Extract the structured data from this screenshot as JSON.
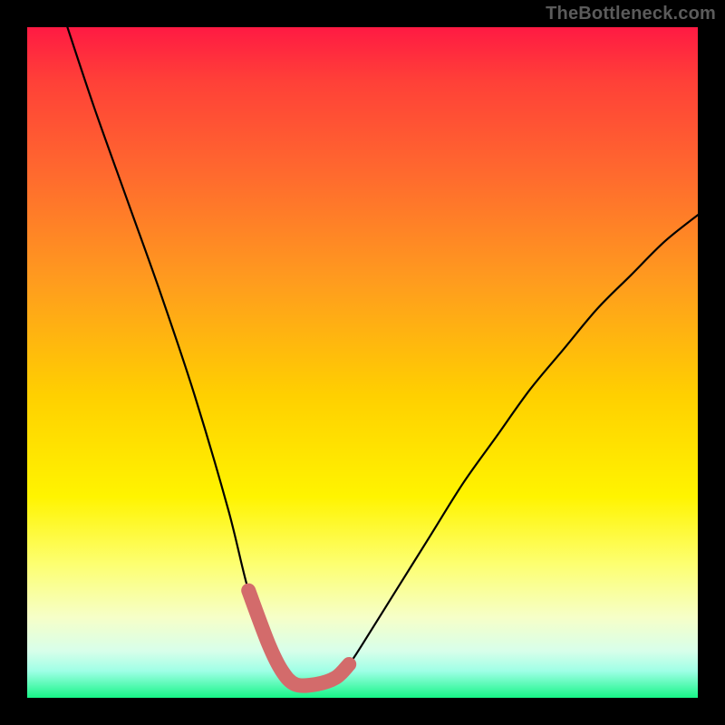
{
  "watermark": "TheBottleneck.com",
  "colors": {
    "gradient_top": "#ff1a43",
    "gradient_bottom": "#17f587",
    "curve": "#000000",
    "nadir": "#d36b6b",
    "frame": "#000000",
    "watermark": "#5b5b5b"
  },
  "chart_data": {
    "type": "line",
    "title": "",
    "xlabel": "",
    "ylabel": "",
    "xlim": [
      0,
      100
    ],
    "ylim": [
      0,
      100
    ],
    "note": "Values are horizontal position (0=left, 100=right) vs bottleneck percentage (0=none at bottom, 100=max at top). Curve shape estimated from pixel positions.",
    "series": [
      {
        "name": "bottleneck-curve",
        "x": [
          6,
          10,
          15,
          20,
          25,
          30,
          33,
          36,
          38,
          40,
          43,
          46,
          48,
          50,
          55,
          60,
          65,
          70,
          75,
          80,
          85,
          90,
          95,
          100
        ],
        "y": [
          100,
          88,
          74,
          60,
          45,
          28,
          16,
          8,
          4,
          2,
          2,
          3,
          5,
          8,
          16,
          24,
          32,
          39,
          46,
          52,
          58,
          63,
          68,
          72
        ]
      }
    ],
    "nadir_range_x": [
      33,
      48
    ],
    "nadir_value": 2
  }
}
